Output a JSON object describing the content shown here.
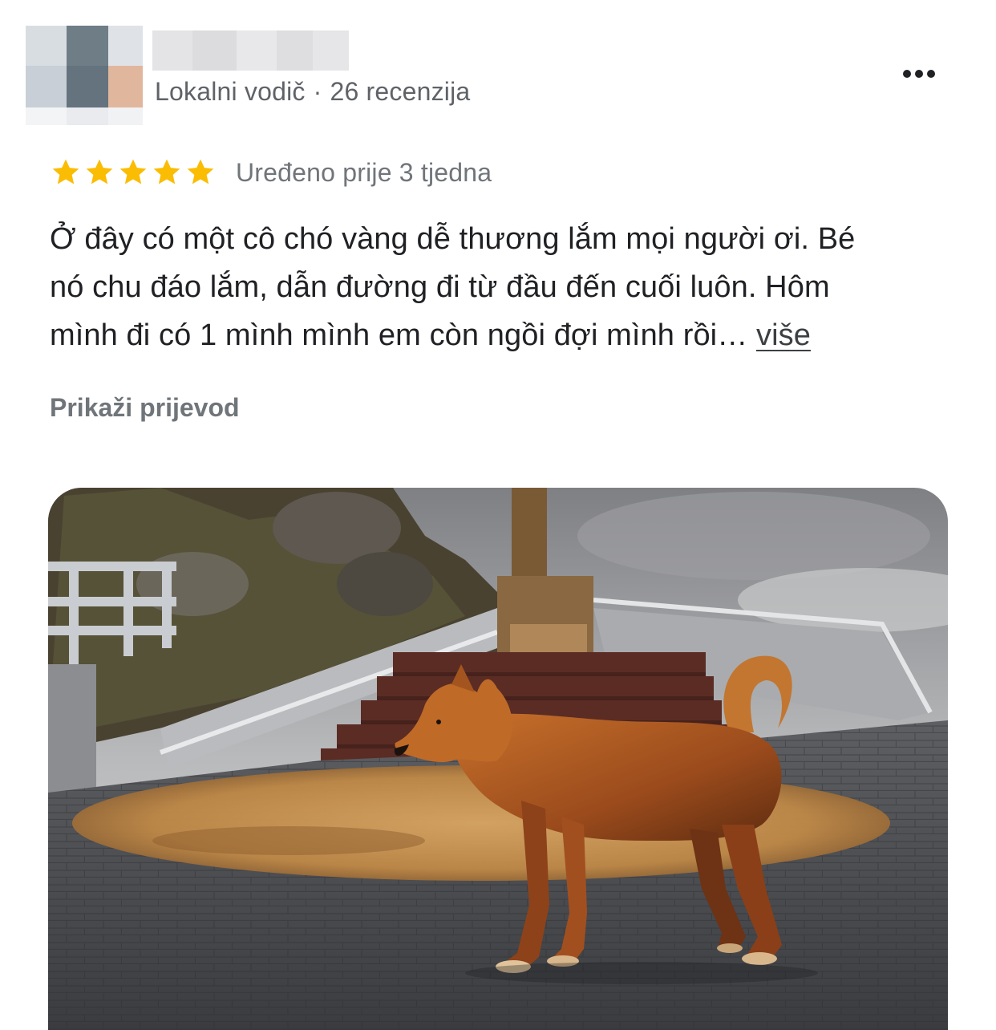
{
  "reviewer": {
    "subtitle_role": "Lokalni vodič",
    "subtitle_sep": "·",
    "subtitle_count": "26 recenzija",
    "avatar_blur_colors": [
      "#d8dde2",
      "#6f7d86",
      "#dfe3e8",
      "#c9cfd6",
      "#64737d",
      "#e0b79c",
      "#f3f4f6",
      "#e9ebee",
      "#f1f2f4"
    ],
    "name_blur_colors": [
      "#e4e4e6",
      "#dcdcde",
      "#e8e8ea",
      "#dedee0",
      "#e6e6e8"
    ]
  },
  "menu": {
    "icon": "more-horizontal-icon"
  },
  "rating": {
    "stars": 5,
    "max": 5,
    "star_color": "#fbbc04",
    "edited": "Uređeno prije 3 tjedna"
  },
  "review": {
    "lines": [
      "Ở đây có một cô chó vàng dễ thương lắm mọi người ơi. Bé",
      "nó chu đáo lắm, dẫn đường đi từ đầu đến cuối luôn. Hôm",
      "mình đi có 1 mình mình em còn ngồi đợi mình rồi… "
    ],
    "more_label": "više"
  },
  "translate": {
    "label": "Prikaži prijevod"
  },
  "photo": {
    "description_icon": "review-photo"
  },
  "colors": {
    "text": "#202124",
    "secondary": "#70757a"
  }
}
